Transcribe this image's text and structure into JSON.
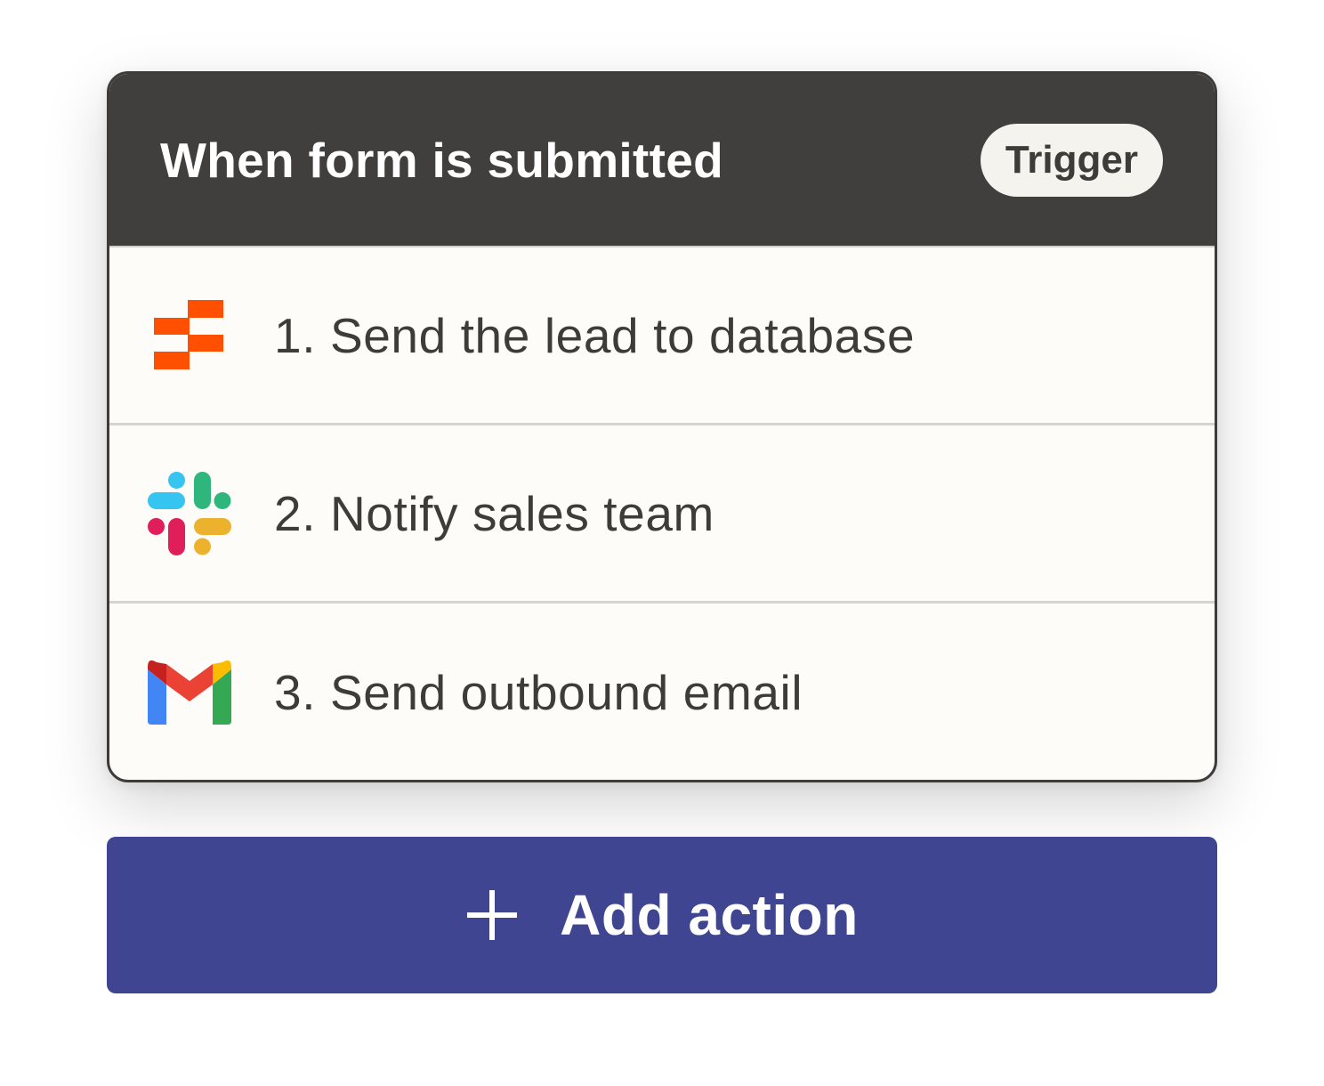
{
  "trigger": {
    "title": "When form is submitted",
    "badge": "Trigger"
  },
  "steps": [
    {
      "label": "1. Send the lead to database",
      "icon": "zapier-tables-icon"
    },
    {
      "label": "2. Notify sales team",
      "icon": "slack-icon"
    },
    {
      "label": "3. Send outbound email",
      "icon": "gmail-icon"
    }
  ],
  "add_action": {
    "label": "Add action",
    "icon": "plus-icon"
  },
  "colors": {
    "header_bg": "#403f3d",
    "card_bg": "#fdfcf8",
    "button_bg": "#3f4591",
    "badge_bg": "#f5f3ee",
    "tables_orange": "#ff4f00"
  }
}
